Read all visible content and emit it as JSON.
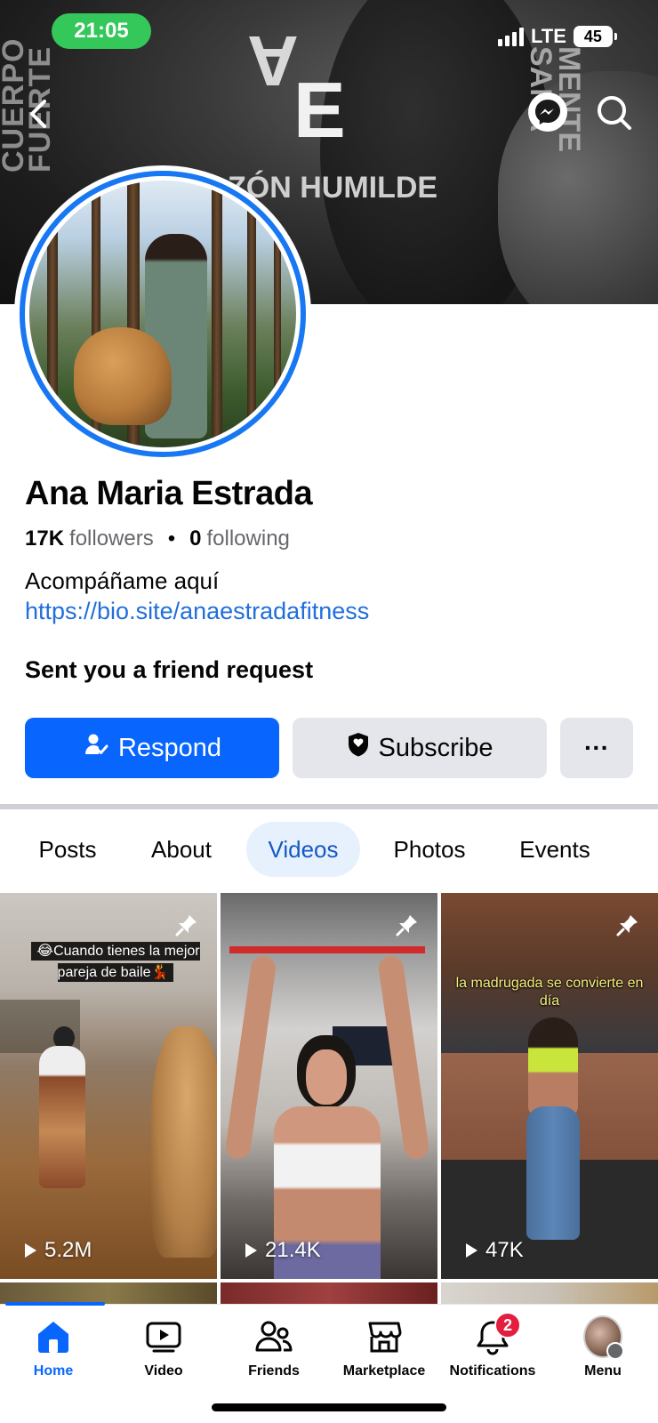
{
  "status_bar": {
    "time": "21:05",
    "network": "LTE",
    "battery": "45"
  },
  "cover": {
    "left_text": "CUERPO FUERTE",
    "right_text": "MENTE SANA",
    "logo_a": "A",
    "logo_e": "E",
    "tagline": "ZÓN HUMILDE"
  },
  "profile": {
    "name": "Ana Maria Estrada",
    "followers_count": "17K",
    "followers_label": "followers",
    "following_count": "0",
    "following_label": "following",
    "bio": "Acompáñame aquí",
    "link": "https://bio.site/anaestradafitness",
    "friend_request_text": "Sent you a friend request"
  },
  "actions": {
    "respond": "Respond",
    "subscribe": "Subscribe",
    "more": "···"
  },
  "tabs": [
    {
      "label": "Posts",
      "active": false
    },
    {
      "label": "About",
      "active": false
    },
    {
      "label": "Videos",
      "active": true
    },
    {
      "label": "Photos",
      "active": false
    },
    {
      "label": "Events",
      "active": false
    }
  ],
  "videos": [
    {
      "caption": "😂Cuando tienes la mejor pareja de baile💃",
      "views": "5.2M",
      "pinned": true
    },
    {
      "caption": "",
      "views": "21.4K",
      "pinned": true
    },
    {
      "caption": "la madrugada se convierte en día",
      "views": "47K",
      "pinned": true
    }
  ],
  "bottom_nav": {
    "items": [
      {
        "label": "Home",
        "icon": "home-icon",
        "active": true
      },
      {
        "label": "Video",
        "icon": "video-icon",
        "active": false
      },
      {
        "label": "Friends",
        "icon": "friends-icon",
        "active": false
      },
      {
        "label": "Marketplace",
        "icon": "marketplace-icon",
        "active": false
      },
      {
        "label": "Notifications",
        "icon": "bell-icon",
        "active": false,
        "badge": "2"
      },
      {
        "label": "Menu",
        "icon": "menu-avatar",
        "active": false
      }
    ]
  },
  "colors": {
    "accent": "#0866ff",
    "link": "#216fdb",
    "badge": "#e41e3f",
    "time_pill": "#34c759"
  }
}
